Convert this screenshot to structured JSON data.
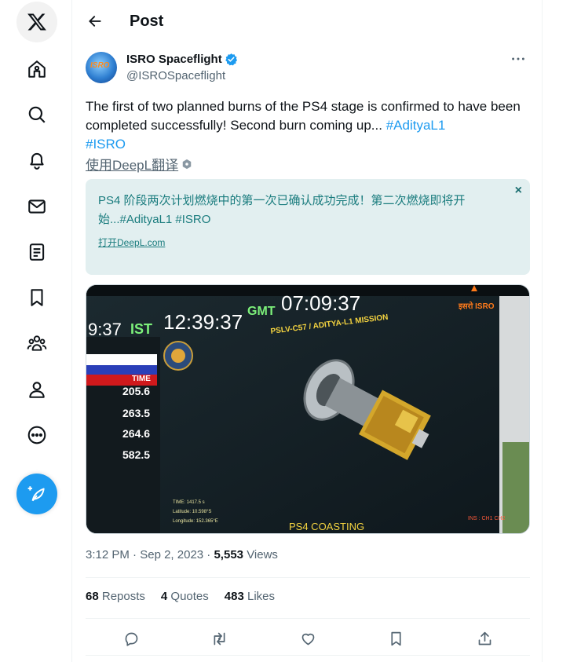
{
  "header": {
    "title": "Post"
  },
  "nav": {
    "icons": [
      "x-logo-icon",
      "home-icon",
      "search-icon",
      "notifications-icon",
      "messages-icon",
      "lists-icon",
      "bookmarks-icon",
      "communities-icon",
      "profile-icon",
      "more-icon"
    ],
    "compose_icon": "compose-icon"
  },
  "author": {
    "name": "ISRO Spaceflight",
    "handle": "@ISROSpaceflight",
    "avatar_text": "ISRO",
    "verified": true
  },
  "tweet": {
    "text_main": "The first of two planned burns of the PS4 stage is confirmed to have been completed successfully! Second burn coming up... ",
    "hashtag1": "#AdityaL1",
    "hashtag2": "#ISRO",
    "translate_label": "使用DeepL翻译"
  },
  "translation": {
    "text": "PS4 阶段两次计划燃烧中的第一次已确认成功完成！第二次燃烧即将开始...#AdityaL1 #ISRO",
    "link": "打开DeepL.com",
    "close": "×"
  },
  "media": {
    "ist_label": "IST",
    "ist_left": "9:37",
    "ist_time": "12:39:37",
    "gmt_label": "GMT",
    "gmt_time": "07:09:37",
    "mission": "PSLV-C57 / ADITYA-L1 MISSION",
    "time_header": "TIME",
    "times": [
      "205.6",
      "263.5",
      "264.6",
      "582.5"
    ],
    "caption": "PS4 COASTING",
    "isro_logo": "इसरो ISRO",
    "telemetry": [
      "TIME: 1417.5 s",
      "Latitude: 10.598°S",
      "Longitude: 152.365°E"
    ],
    "ins": "INS : CH1 CH2"
  },
  "meta": {
    "time": "3:12 PM",
    "date": "Sep 2, 2023",
    "views_count": "5,553",
    "views_label": "Views"
  },
  "stats": {
    "reposts_count": "68",
    "reposts_label": "Reposts",
    "quotes_count": "4",
    "quotes_label": "Quotes",
    "likes_count": "483",
    "likes_label": "Likes"
  },
  "colors": {
    "accent": "#1d9bf0",
    "translation_bg": "#e2eff0",
    "translation_text": "#1a7c7e"
  }
}
